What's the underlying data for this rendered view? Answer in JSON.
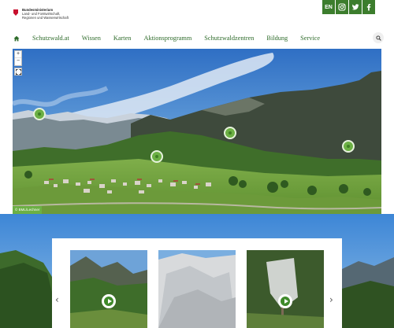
{
  "header": {
    "logo_lines": [
      "Bundesministerium",
      "Land- und Forstwirtschaft,",
      "Regionen und Wasserwirtschaft"
    ],
    "lang_button": "EN",
    "social": [
      {
        "icon": "instagram-icon"
      },
      {
        "icon": "twitter-icon"
      },
      {
        "icon": "facebook-icon"
      }
    ]
  },
  "nav": {
    "items": [
      "Schutzwald.at",
      "Wissen",
      "Karten",
      "Aktionsprogramm",
      "Schutzwaldzentren",
      "Bildung",
      "Service"
    ]
  },
  "panorama": {
    "zoom_in": "+",
    "zoom_out": "−",
    "hotspot_count": 4,
    "info_tag": "© BML/Lechner"
  },
  "carousel": {
    "prev": "‹",
    "next": "›",
    "thumbnails": [
      {
        "has_play": true
      },
      {
        "has_play": false
      },
      {
        "has_play": true
      }
    ]
  },
  "colors": {
    "brand_green": "#3c7d2d",
    "hotspot_green": "#6cb044",
    "logo_red": "#c8102e"
  }
}
